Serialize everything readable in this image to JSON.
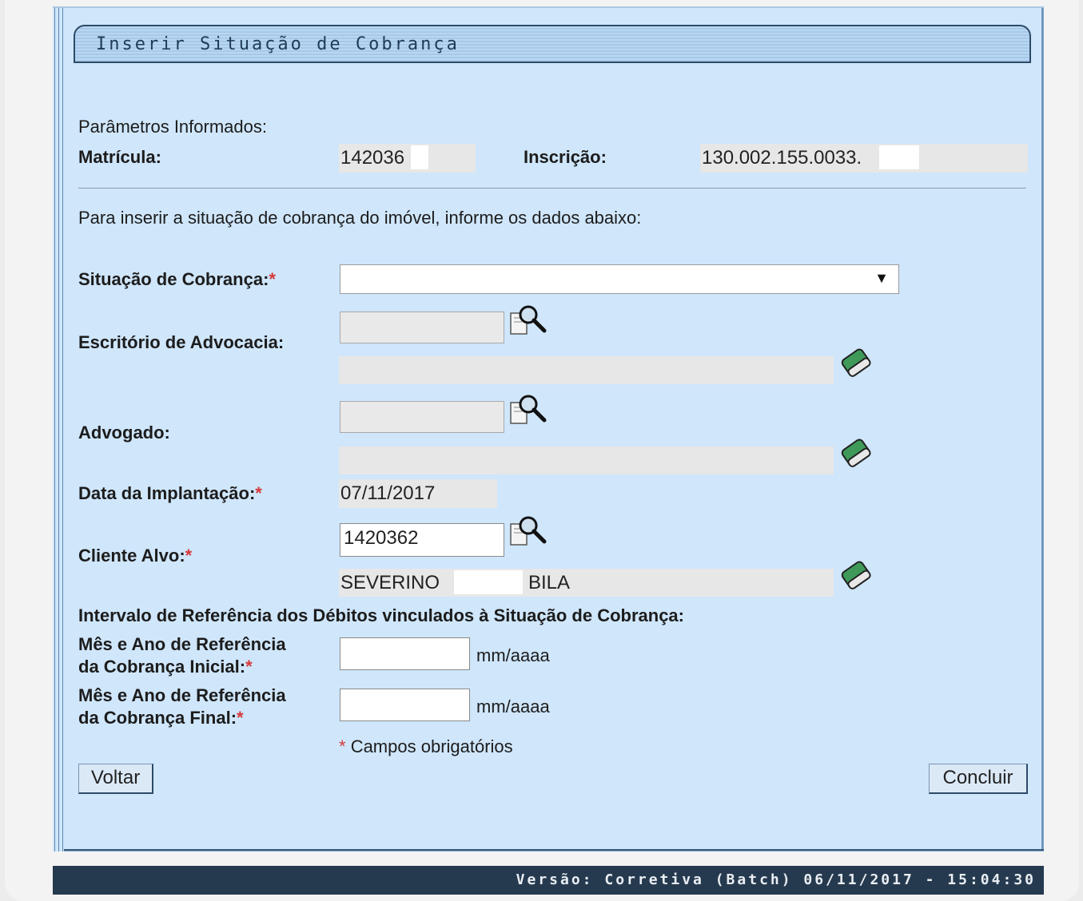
{
  "title": "Inserir Situação de Cobrança",
  "params": {
    "heading": "Parâmetros Informados:",
    "matricula_label": "Matrícula:",
    "matricula_value": "142036",
    "inscricao_label": "Inscrição:",
    "inscricao_value": "130.002.155.0033."
  },
  "instructions": "Para inserir a situação de cobrança do imóvel, informe os dados abaixo:",
  "form": {
    "situacao_label": "Situação de Cobrança:",
    "escritorio_label": "Escritório de Advocacia:",
    "advogado_label": "Advogado:",
    "data_label": "Data da Implantação:",
    "data_value": "07/11/2017",
    "cliente_label": "Cliente Alvo:",
    "cliente_code": "1420362",
    "cliente_name_first": "SEVERINO",
    "cliente_name_last": "BILA",
    "intervalo_label": "Intervalo de Referência dos Débitos vinculados à Situação de Cobrança:",
    "inicial_label_line1": "Mês e Ano de Referência",
    "inicial_label_line2": "da Cobrança Inicial:",
    "final_label_line1": "Mês e Ano de Referência",
    "final_label_line2": "da Cobrança Final:",
    "date_hint": "mm/aaaa",
    "required_asterisk": "*",
    "required_note": "Campos obrigatórios"
  },
  "buttons": {
    "voltar": "Voltar",
    "concluir": "Concluir"
  },
  "footer": "Versão: Corretiva (Batch) 06/11/2017 - 15:04:30",
  "icons": [
    "search-icon",
    "eraser-icon"
  ]
}
